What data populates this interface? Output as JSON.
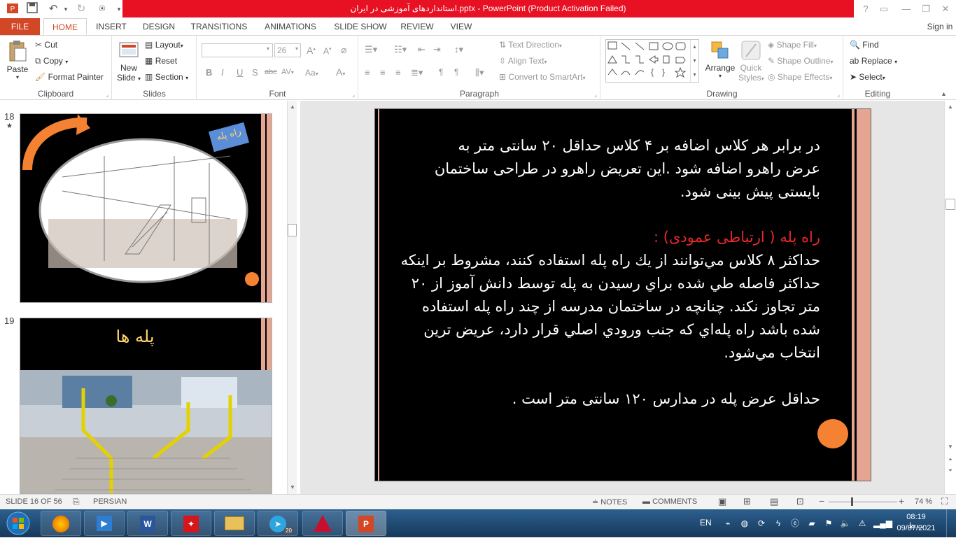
{
  "window": {
    "title": "استانداردهای آموزشی در ایران.pptx -  PowerPoint (Product Activation Failed)",
    "help": "?",
    "sign_in": "Sign in"
  },
  "tabs": [
    "FILE",
    "HOME",
    "INSERT",
    "DESIGN",
    "TRANSITIONS",
    "ANIMATIONS",
    "SLIDE SHOW",
    "REVIEW",
    "VIEW"
  ],
  "ribbon": {
    "clipboard": {
      "paste": "Paste",
      "cut": "Cut",
      "copy": "Copy",
      "format_painter": "Format Painter",
      "label": "Clipboard"
    },
    "slides": {
      "new_slide": "New",
      "new_slide2": "Slide",
      "layout": "Layout",
      "reset": "Reset",
      "section": "Section",
      "label": "Slides"
    },
    "font": {
      "size": "26",
      "bold": "B",
      "italic": "I",
      "underline": "U",
      "shadow": "S",
      "strike": "abc",
      "spacing": "AV",
      "case": "Aa",
      "color": "A",
      "grow": "A",
      "shrink": "A",
      "label": "Font"
    },
    "paragraph": {
      "text_direction": "Text Direction",
      "align_text": "Align Text",
      "smartart": "Convert to SmartArt",
      "label": "Paragraph"
    },
    "drawing": {
      "arrange": "Arrange",
      "quick_styles": "Quick",
      "quick_styles2": "Styles",
      "shape_fill": "Shape Fill",
      "shape_outline": "Shape Outline",
      "shape_effects": "Shape Effects",
      "label": "Drawing"
    },
    "editing": {
      "find": "Find",
      "replace": "Replace",
      "select": "Select",
      "label": "Editing"
    }
  },
  "thumbnails": [
    {
      "number": "18",
      "mark": "★",
      "badge": "راه پله"
    },
    {
      "number": "19",
      "title": "پله ها"
    }
  ],
  "slide": {
    "para1": [
      "در برابر هر كلاس اضافه بر ۴ کلاس حداقل ۲۰ سانتی متر به",
      "عرض راهرو اضافه شود .این تعریض راهرو در طراحی ساختمان",
      "بایستی پیش بینی شود."
    ],
    "heading": "راه پله ( ارتباطی عمودی) :",
    "para2": [
      "حداكثر ۸ كلاس مي‌توانند از يك راه پله استفاده كنند، مشروط بر اينكه",
      "حداكثر فاصله طي شده براي رسيدن به پله توسط دانش آموز از ۲۰",
      "متر تجاوز نكند. چنانچه در ساختمان مدرسه از چند راه پله استفاده",
      "شده باشد راه پله‌اي كه جنب ورودي اصلي قرار دارد، عريض ترين",
      "انتخاب مي‌شود."
    ],
    "para3": "حداقل عرض پله در مدارس ۱۲۰ سانتی متر است .",
    "colors": {
      "heading": "#e8282b",
      "accent": "#f58232",
      "stripe": "#e4a692",
      "text": "#ffffff",
      "background": "#000000"
    }
  },
  "status": {
    "slide": "SLIDE 16 OF 56",
    "language": "PERSIAN",
    "notes": "NOTES",
    "comments": "COMMENTS",
    "zoom": "74 %"
  },
  "taskbar": {
    "lang": "EN",
    "time": "08:19 ب.ظ",
    "date": "09/07/2021",
    "telegram_badge": "20"
  }
}
